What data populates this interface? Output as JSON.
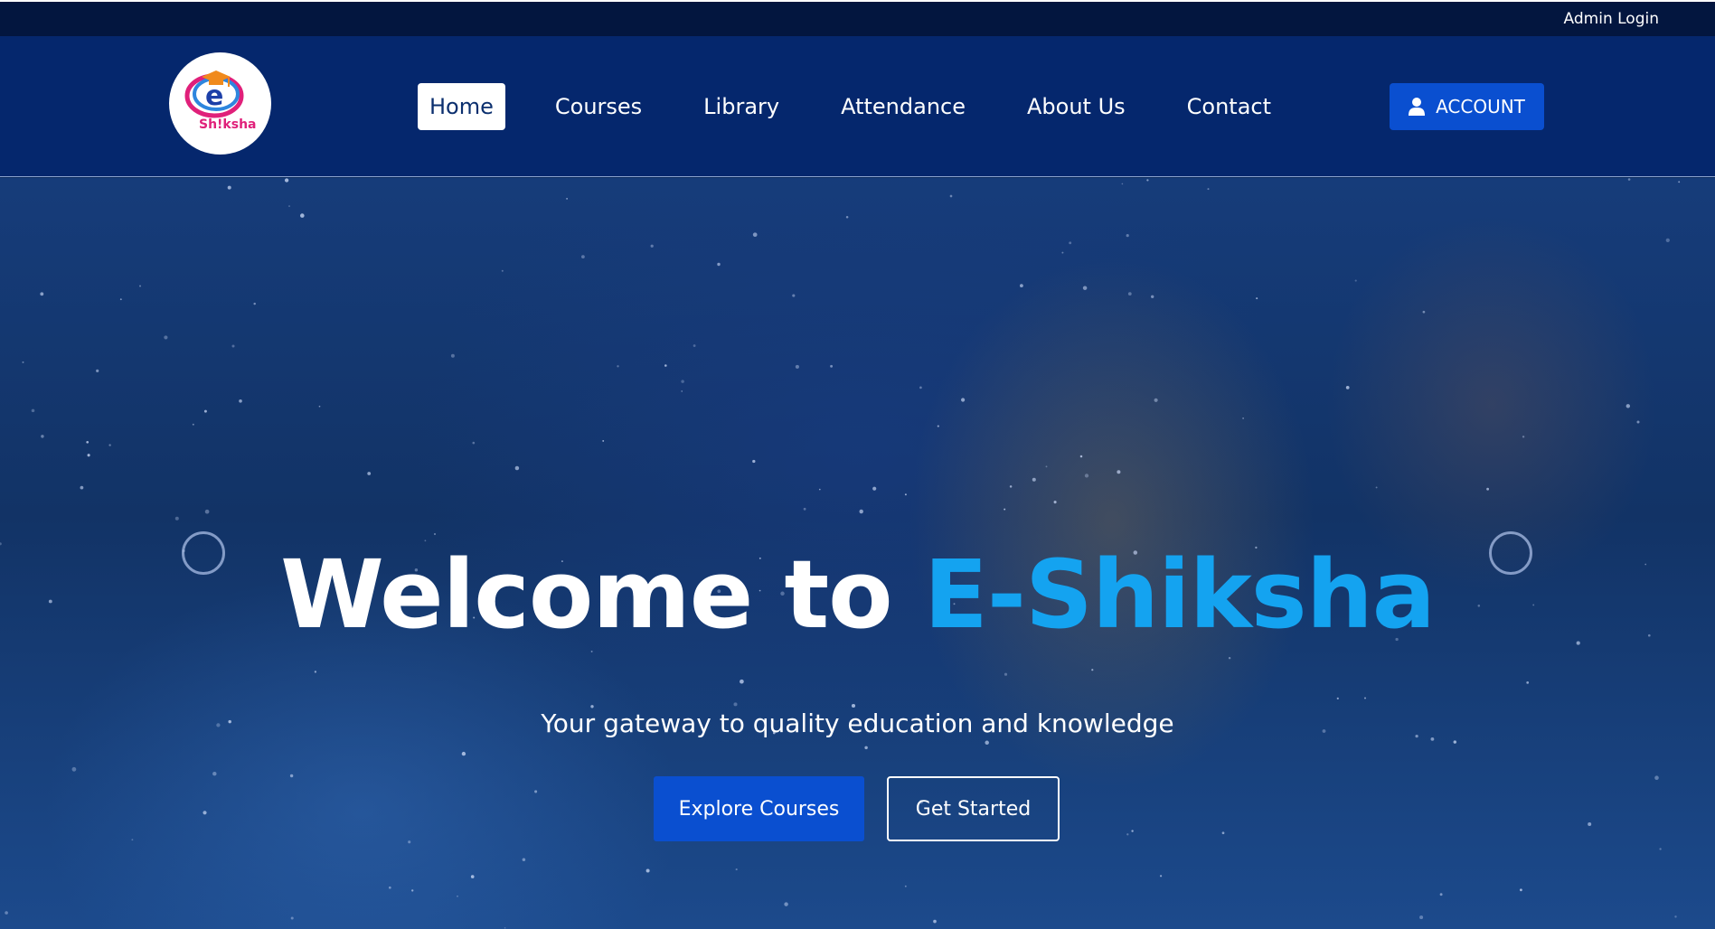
{
  "topbar": {
    "admin_login": "Admin Login"
  },
  "header": {
    "logo": {
      "text": "Sh!ksha",
      "letter": "e"
    },
    "nav": [
      {
        "label": "Home",
        "active": true
      },
      {
        "label": "Courses"
      },
      {
        "label": "Library"
      },
      {
        "label": "Attendance"
      },
      {
        "label": "About Us"
      },
      {
        "label": "Contact"
      }
    ],
    "account": {
      "label": "ACCOUNT",
      "icon": "user-icon"
    }
  },
  "hero": {
    "title_prefix": "Welcome to",
    "title_accent": "E-Shiksha",
    "subtitle": "Your gateway to quality education and knowledge",
    "explore_button": "Explore Courses",
    "started_button": "Get Started",
    "carousel": {
      "prev_icon": "circle-prev-icon",
      "next_icon": "circle-next-icon"
    }
  },
  "colors": {
    "topbar": "#03163f",
    "header": "#05276d",
    "primary_button": "#0a4fd0",
    "accent_text": "#14a3f0"
  }
}
